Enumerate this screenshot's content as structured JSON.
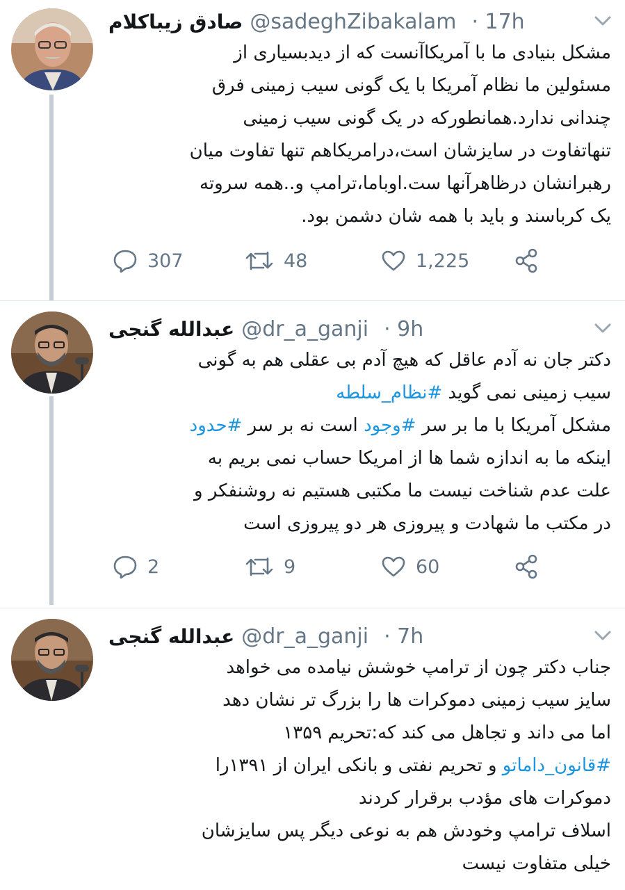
{
  "colors": {
    "link": "#1b95e0",
    "muted": "#657786",
    "text": "#14171a",
    "thread_line": "#c5ced6"
  },
  "tweets": [
    {
      "name": "صادق زیباکلام",
      "handle": "@sadeghZibakalam",
      "time": "· 17h",
      "avatar_icon": "avatar-photo",
      "lines": [
        [
          {
            "text": "مشکل بنیادی ما با آمریکاآنست که از دیدبسیاری از"
          }
        ],
        [
          {
            "text": "مسئولین ما نظام آمریکا با یک گونی سیب زمینی فرق"
          }
        ],
        [
          {
            "text": "چندانی ندارد.همانطورکه در یک گونی سیب زمینی"
          }
        ],
        [
          {
            "text": "تنهاتفاوت در سایزشان است،درامریکاهم تنها تفاوت میان"
          }
        ],
        [
          {
            "text": "رهبرانشان درظاهرآنها ست.اوباما،ترامپ و..همه سروته"
          }
        ],
        [
          {
            "text": "یک کرباسند و باید با همه شان دشمن بود."
          }
        ]
      ],
      "replies": "307",
      "retweets": "48",
      "likes": "1,225"
    },
    {
      "name": "عبدالله گنجی",
      "handle": "@dr_a_ganji",
      "time": "· 9h",
      "avatar_icon": "avatar-photo",
      "lines": [
        [
          {
            "text": "دکتر جان نه آدم عاقل که هیچ آدم بی عقلی هم به گونی"
          }
        ],
        [
          {
            "text": "سیب زمینی نمی گوید "
          },
          {
            "text": "#نظام_سلطه",
            "tag": true
          }
        ],
        [
          {
            "text": "مشکل آمریکا با ما بر سر "
          },
          {
            "text": "#وجود",
            "tag": true
          },
          {
            "text": " است نه بر سر "
          },
          {
            "text": "#حدود",
            "tag": true
          }
        ],
        [
          {
            "text": "اینکه ما به اندازه شما ها از امریکا حساب نمی بریم به"
          }
        ],
        [
          {
            "text": "علت عدم شناخت نیست ما مکتبی هستیم نه روشنفکر و"
          }
        ],
        [
          {
            "text": "در مکتب ما شهادت و پیروزی هر دو پیروزی است"
          }
        ]
      ],
      "replies": "2",
      "retweets": "9",
      "likes": "60"
    },
    {
      "name": "عبدالله گنجی",
      "handle": "@dr_a_ganji",
      "time": "· 7h",
      "avatar_icon": "avatar-photo",
      "lines": [
        [
          {
            "text": "جناب دکتر چون از ترامپ خوشش نیامده می خواهد"
          }
        ],
        [
          {
            "text": "سایز سیب زمینی دموکرات ها را بزرگ تر نشان دهد"
          }
        ],
        [
          {
            "text": "اما می داند و تجاهل می کند که:تحریم ۱۳۵۹"
          }
        ],
        [
          {
            "text": "#قانون_داماتو",
            "tag": true
          },
          {
            "text": " و تحریم نفتی و بانکی ایران از ۱۳۹۱را"
          }
        ],
        [
          {
            "text": "دموکرات های مؤدب برقرار کردند"
          }
        ],
        [
          {
            "text": "اسلاف ترامپ  وخودش هم به نوعی دیگر پس سایزشان"
          }
        ],
        [
          {
            "text": "خیلی متفاوت نیست"
          }
        ]
      ]
    }
  ]
}
